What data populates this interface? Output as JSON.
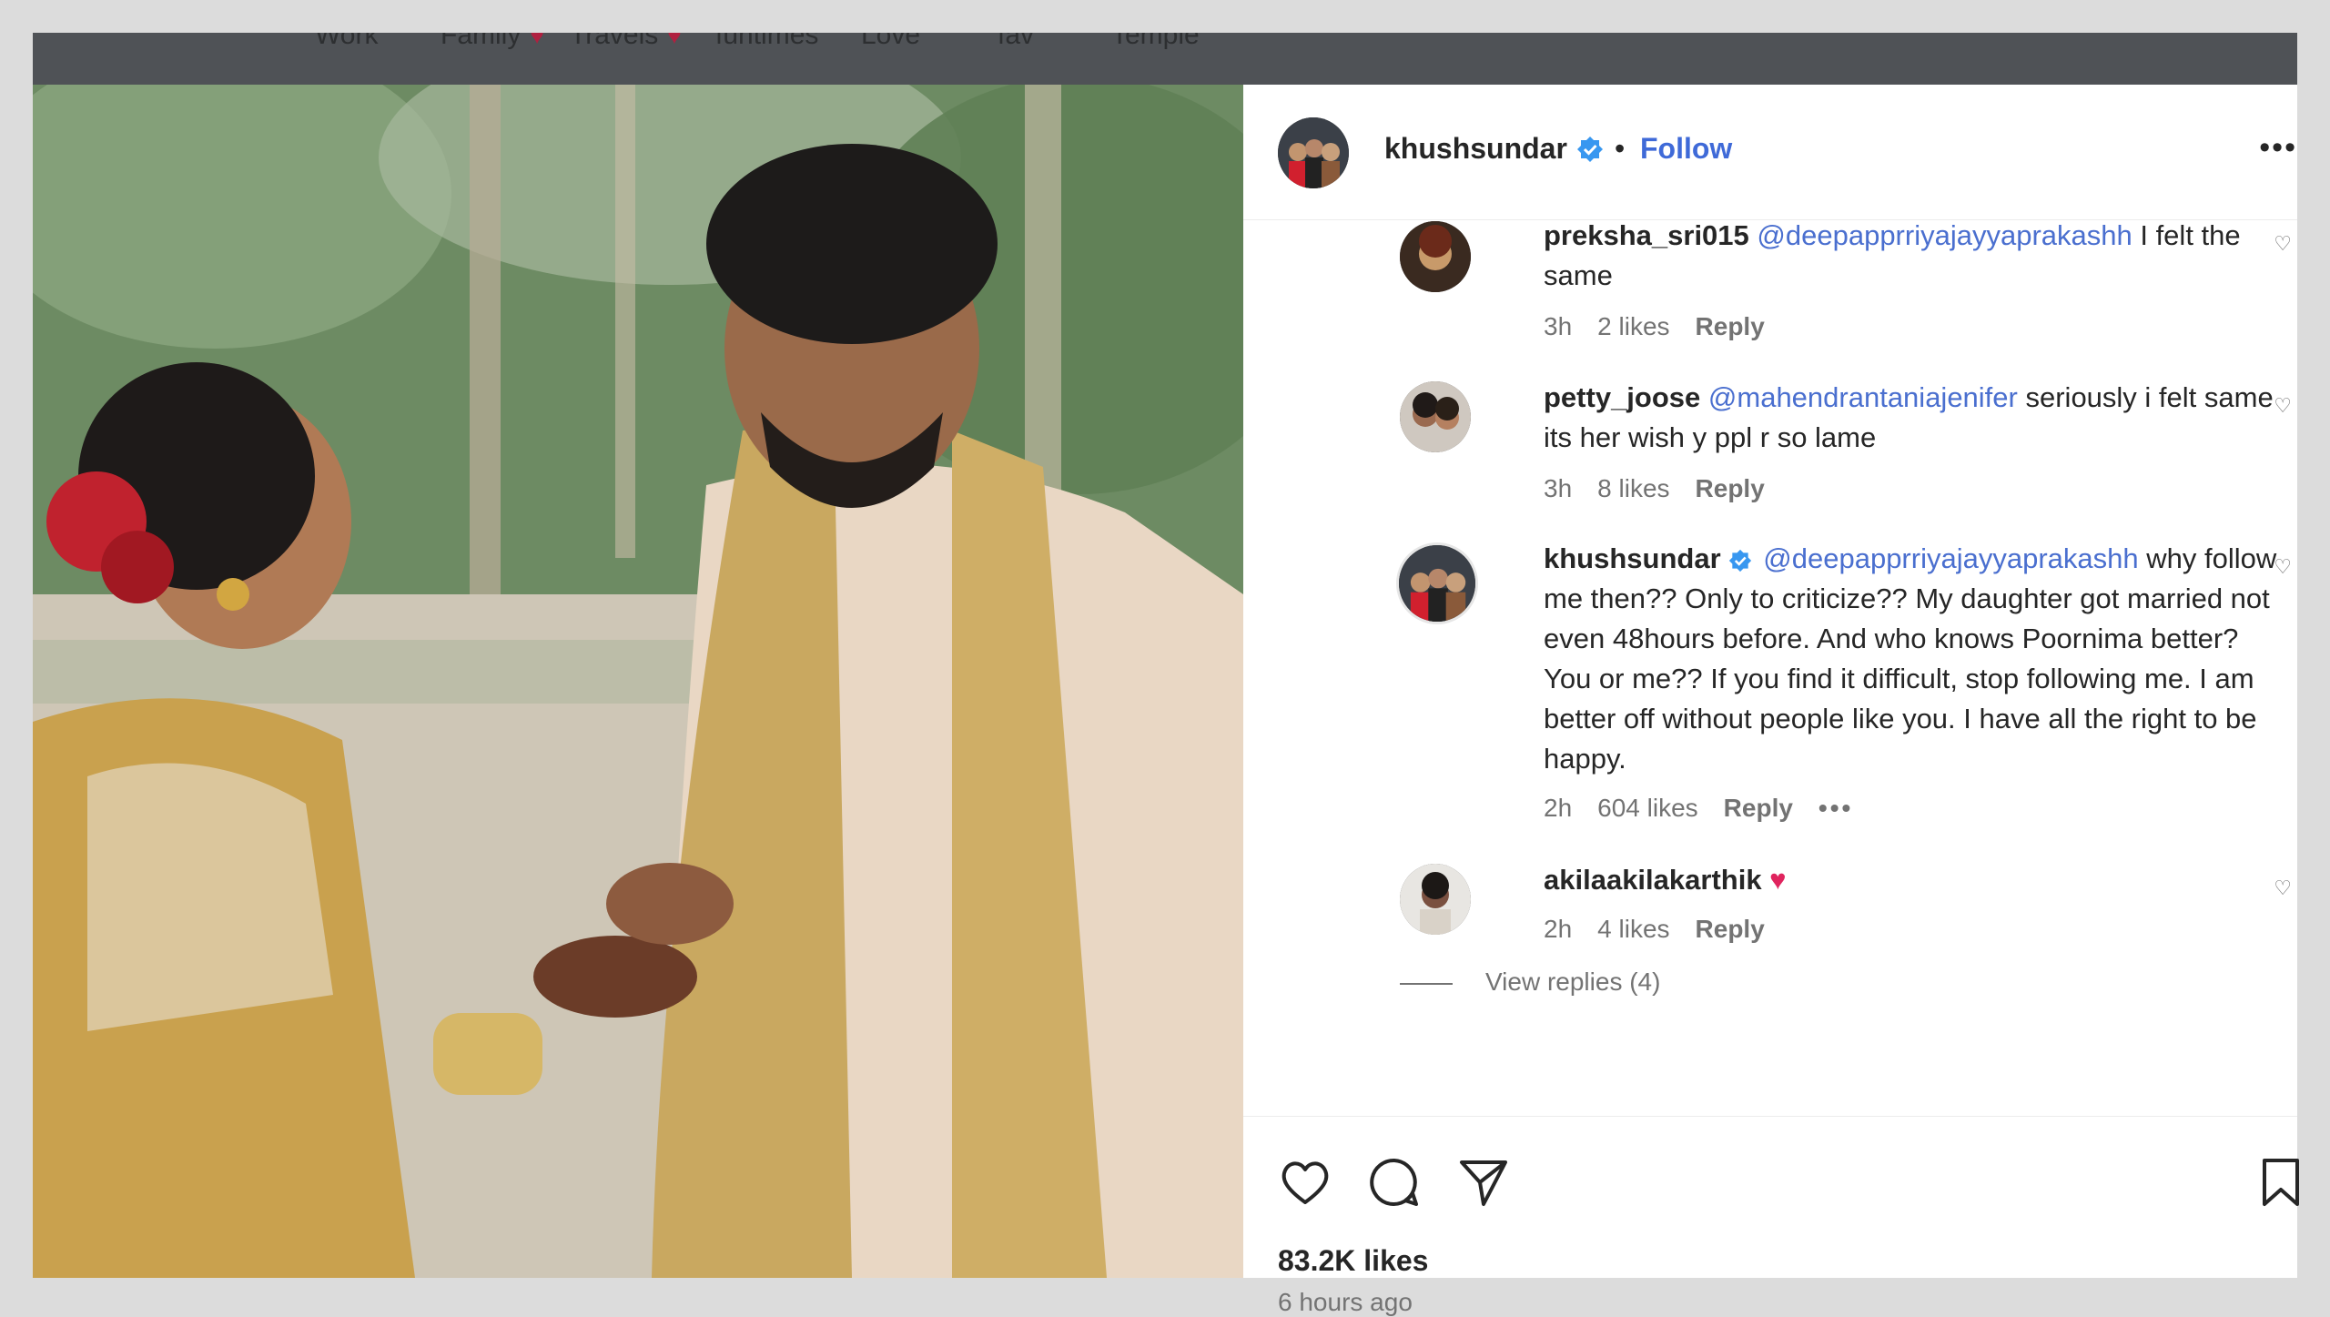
{
  "highlights": [
    {
      "label": "Work",
      "heart": false
    },
    {
      "label": "Family",
      "heart": true
    },
    {
      "label": "Travels",
      "heart": true
    },
    {
      "label": "funtimes",
      "heart": false
    },
    {
      "label": "Love",
      "heart": false
    },
    {
      "label": "fav",
      "heart": false
    },
    {
      "label": "Temple",
      "heart": false
    }
  ],
  "post": {
    "username": "khushsundar",
    "separator": "•",
    "follow_label": "Follow",
    "more_label": "•••",
    "likes": "83.2K likes",
    "time_ago": "6 hours ago"
  },
  "comments": [
    {
      "username": "preksha_sri015",
      "mention": "@deepapprriyajayyaprakashh",
      "text": " I felt the same",
      "time": "3h",
      "likes": "2 likes",
      "reply": "Reply",
      "verified": false
    },
    {
      "username": "petty_joose",
      "mention": "@mahendrantaniajenifer",
      "text": " seriously i felt same its her wish y ppl r so lame",
      "time": "3h",
      "likes": "8 likes",
      "reply": "Reply",
      "verified": false
    },
    {
      "username": "khushsundar",
      "mention": "@deepapprriyajayyaprakashh",
      "text": " why follow me then?? Only to criticize?? My daughter got married not even 48hours before. And who knows Poornima better? You or me?? If you find it difficult, stop following me. I am better off without people like you. I have all the right to be happy.",
      "time": "2h",
      "likes": "604 likes",
      "reply": "Reply",
      "more": "•••",
      "verified": true
    },
    {
      "username": "akilaakilakarthik",
      "mention": "",
      "text": " ♥",
      "time": "2h",
      "likes": "4 likes",
      "reply": "Reply",
      "verified": false
    }
  ],
  "view_replies": "View replies (4)",
  "icons": {
    "like": "heart-icon",
    "comment": "comment-icon",
    "share": "share-icon",
    "save": "bookmark-icon",
    "verified": "verified-badge-icon",
    "comment_like": "heart-outline-icon"
  },
  "colors": {
    "accent": "#3f6ad8",
    "mention": "#4a6fcf",
    "heart_emoji": "#e0245e",
    "topbar": "#4f5256"
  }
}
